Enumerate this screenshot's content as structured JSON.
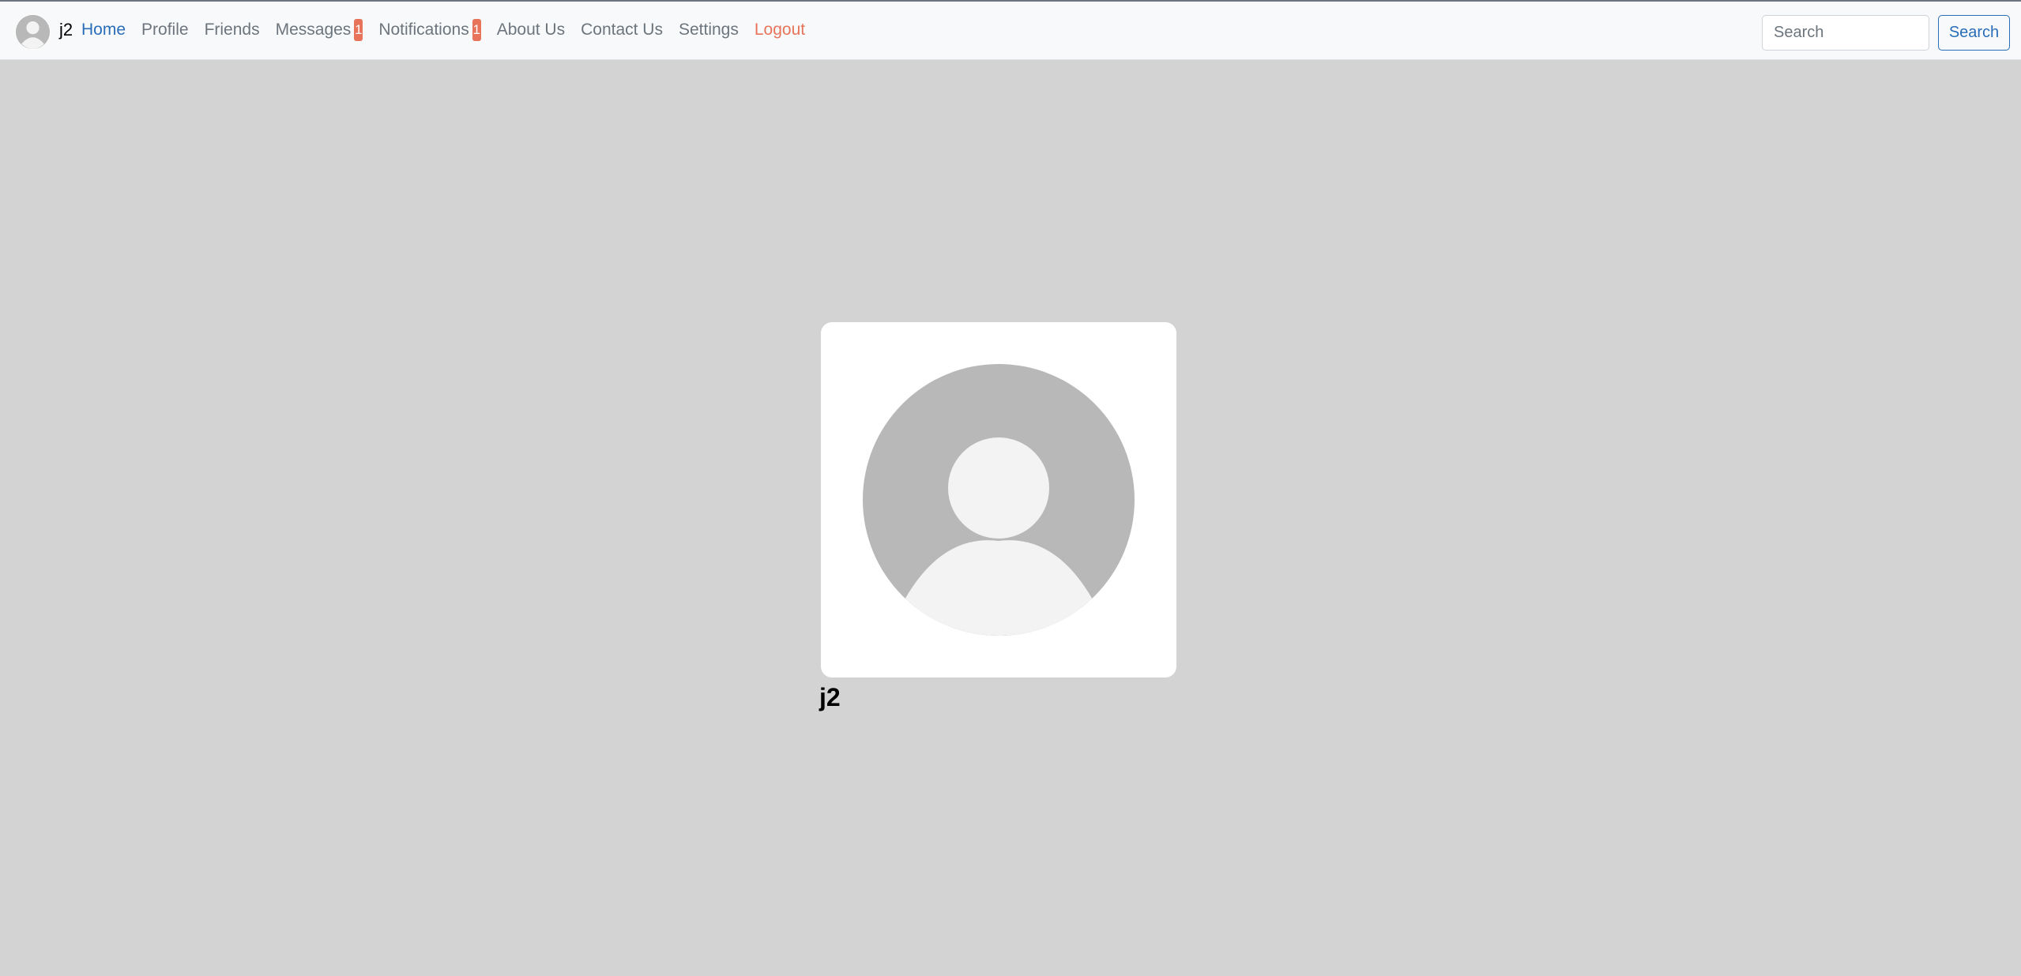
{
  "navbar": {
    "username": "j2",
    "links": [
      {
        "label": "Home",
        "active": true
      },
      {
        "label": "Profile"
      },
      {
        "label": "Friends"
      },
      {
        "label": "Messages",
        "badge": "1"
      },
      {
        "label": "Notifications",
        "badge": "1"
      },
      {
        "label": "About Us"
      },
      {
        "label": "Contact Us"
      },
      {
        "label": "Settings"
      },
      {
        "label": "Logout"
      }
    ],
    "search": {
      "placeholder": "Search",
      "button_label": "Search"
    }
  },
  "profile": {
    "name": "j2",
    "avatar_icon": "default-user-avatar-icon"
  },
  "colors": {
    "accent": "#2a6db8",
    "danger": "#e8735b",
    "background": "#d3d3d3"
  }
}
